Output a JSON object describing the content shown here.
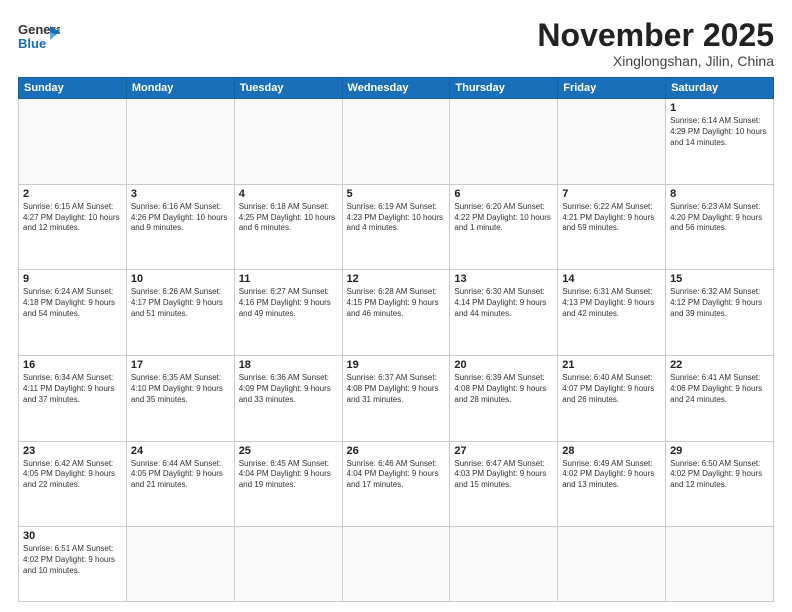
{
  "header": {
    "logo_line1": "General",
    "logo_line2": "Blue",
    "title": "November 2025",
    "subtitle": "Xinglongshan, Jilin, China"
  },
  "weekdays": [
    "Sunday",
    "Monday",
    "Tuesday",
    "Wednesday",
    "Thursday",
    "Friday",
    "Saturday"
  ],
  "weeks": [
    [
      {
        "day": "",
        "info": ""
      },
      {
        "day": "",
        "info": ""
      },
      {
        "day": "",
        "info": ""
      },
      {
        "day": "",
        "info": ""
      },
      {
        "day": "",
        "info": ""
      },
      {
        "day": "",
        "info": ""
      },
      {
        "day": "1",
        "info": "Sunrise: 6:14 AM\nSunset: 4:29 PM\nDaylight: 10 hours\nand 14 minutes."
      }
    ],
    [
      {
        "day": "2",
        "info": "Sunrise: 6:15 AM\nSunset: 4:27 PM\nDaylight: 10 hours\nand 12 minutes."
      },
      {
        "day": "3",
        "info": "Sunrise: 6:16 AM\nSunset: 4:26 PM\nDaylight: 10 hours\nand 9 minutes."
      },
      {
        "day": "4",
        "info": "Sunrise: 6:18 AM\nSunset: 4:25 PM\nDaylight: 10 hours\nand 6 minutes."
      },
      {
        "day": "5",
        "info": "Sunrise: 6:19 AM\nSunset: 4:23 PM\nDaylight: 10 hours\nand 4 minutes."
      },
      {
        "day": "6",
        "info": "Sunrise: 6:20 AM\nSunset: 4:22 PM\nDaylight: 10 hours\nand 1 minute."
      },
      {
        "day": "7",
        "info": "Sunrise: 6:22 AM\nSunset: 4:21 PM\nDaylight: 9 hours\nand 59 minutes."
      },
      {
        "day": "8",
        "info": "Sunrise: 6:23 AM\nSunset: 4:20 PM\nDaylight: 9 hours\nand 56 minutes."
      }
    ],
    [
      {
        "day": "9",
        "info": "Sunrise: 6:24 AM\nSunset: 4:18 PM\nDaylight: 9 hours\nand 54 minutes."
      },
      {
        "day": "10",
        "info": "Sunrise: 6:26 AM\nSunset: 4:17 PM\nDaylight: 9 hours\nand 51 minutes."
      },
      {
        "day": "11",
        "info": "Sunrise: 6:27 AM\nSunset: 4:16 PM\nDaylight: 9 hours\nand 49 minutes."
      },
      {
        "day": "12",
        "info": "Sunrise: 6:28 AM\nSunset: 4:15 PM\nDaylight: 9 hours\nand 46 minutes."
      },
      {
        "day": "13",
        "info": "Sunrise: 6:30 AM\nSunset: 4:14 PM\nDaylight: 9 hours\nand 44 minutes."
      },
      {
        "day": "14",
        "info": "Sunrise: 6:31 AM\nSunset: 4:13 PM\nDaylight: 9 hours\nand 42 minutes."
      },
      {
        "day": "15",
        "info": "Sunrise: 6:32 AM\nSunset: 4:12 PM\nDaylight: 9 hours\nand 39 minutes."
      }
    ],
    [
      {
        "day": "16",
        "info": "Sunrise: 6:34 AM\nSunset: 4:11 PM\nDaylight: 9 hours\nand 37 minutes."
      },
      {
        "day": "17",
        "info": "Sunrise: 6:35 AM\nSunset: 4:10 PM\nDaylight: 9 hours\nand 35 minutes."
      },
      {
        "day": "18",
        "info": "Sunrise: 6:36 AM\nSunset: 4:09 PM\nDaylight: 9 hours\nand 33 minutes."
      },
      {
        "day": "19",
        "info": "Sunrise: 6:37 AM\nSunset: 4:08 PM\nDaylight: 9 hours\nand 31 minutes."
      },
      {
        "day": "20",
        "info": "Sunrise: 6:39 AM\nSunset: 4:08 PM\nDaylight: 9 hours\nand 28 minutes."
      },
      {
        "day": "21",
        "info": "Sunrise: 6:40 AM\nSunset: 4:07 PM\nDaylight: 9 hours\nand 26 minutes."
      },
      {
        "day": "22",
        "info": "Sunrise: 6:41 AM\nSunset: 4:06 PM\nDaylight: 9 hours\nand 24 minutes."
      }
    ],
    [
      {
        "day": "23",
        "info": "Sunrise: 6:42 AM\nSunset: 4:05 PM\nDaylight: 9 hours\nand 22 minutes."
      },
      {
        "day": "24",
        "info": "Sunrise: 6:44 AM\nSunset: 4:05 PM\nDaylight: 9 hours\nand 21 minutes."
      },
      {
        "day": "25",
        "info": "Sunrise: 6:45 AM\nSunset: 4:04 PM\nDaylight: 9 hours\nand 19 minutes."
      },
      {
        "day": "26",
        "info": "Sunrise: 6:46 AM\nSunset: 4:04 PM\nDaylight: 9 hours\nand 17 minutes."
      },
      {
        "day": "27",
        "info": "Sunrise: 6:47 AM\nSunset: 4:03 PM\nDaylight: 9 hours\nand 15 minutes."
      },
      {
        "day": "28",
        "info": "Sunrise: 6:49 AM\nSunset: 4:02 PM\nDaylight: 9 hours\nand 13 minutes."
      },
      {
        "day": "29",
        "info": "Sunrise: 6:50 AM\nSunset: 4:02 PM\nDaylight: 9 hours\nand 12 minutes."
      }
    ],
    [
      {
        "day": "30",
        "info": "Sunrise: 6:51 AM\nSunset: 4:02 PM\nDaylight: 9 hours\nand 10 minutes."
      },
      {
        "day": "",
        "info": ""
      },
      {
        "day": "",
        "info": ""
      },
      {
        "day": "",
        "info": ""
      },
      {
        "day": "",
        "info": ""
      },
      {
        "day": "",
        "info": ""
      },
      {
        "day": "",
        "info": ""
      }
    ]
  ]
}
